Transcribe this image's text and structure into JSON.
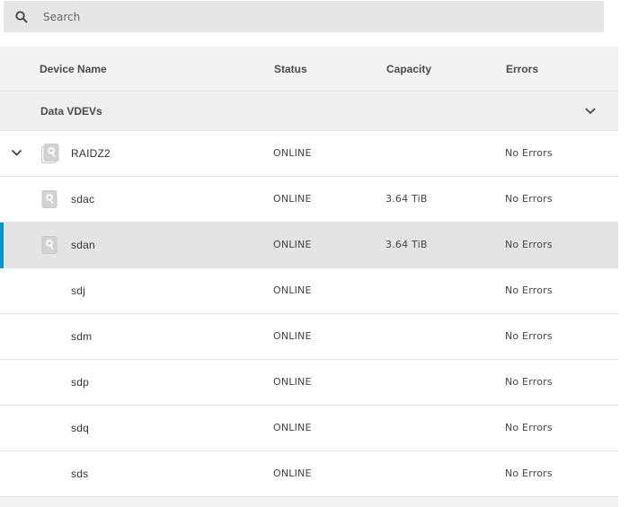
{
  "search": {
    "placeholder": "Search",
    "value": ""
  },
  "columns": {
    "device_name": "Device Name",
    "status": "Status",
    "capacity": "Capacity",
    "errors": "Errors"
  },
  "group": {
    "label": "Data VDEVs",
    "expanded": true
  },
  "rows": [
    {
      "name": "RAIDZ2",
      "status": "ONLINE",
      "capacity": "",
      "errors": "No Errors",
      "icon": "vdev-icon",
      "expanded": true
    },
    {
      "name": "sdac",
      "status": "ONLINE",
      "capacity": "3.64 TiB",
      "errors": "No Errors",
      "icon": "disk-icon"
    },
    {
      "name": "sdan",
      "status": "ONLINE",
      "capacity": "3.64 TiB",
      "errors": "No Errors",
      "icon": "disk-icon",
      "selected": true
    },
    {
      "name": "sdj",
      "status": "ONLINE",
      "capacity": "",
      "errors": "No Errors"
    },
    {
      "name": "sdm",
      "status": "ONLINE",
      "capacity": "",
      "errors": "No Errors"
    },
    {
      "name": "sdp",
      "status": "ONLINE",
      "capacity": "",
      "errors": "No Errors"
    },
    {
      "name": "sdq",
      "status": "ONLINE",
      "capacity": "",
      "errors": "No Errors"
    },
    {
      "name": "sds",
      "status": "ONLINE",
      "capacity": "",
      "errors": "No Errors"
    }
  ],
  "colors": {
    "selection_accent": "#0095d5",
    "selected_row_bg": "#e4e4e4",
    "search_bg": "#e6e6e6"
  }
}
